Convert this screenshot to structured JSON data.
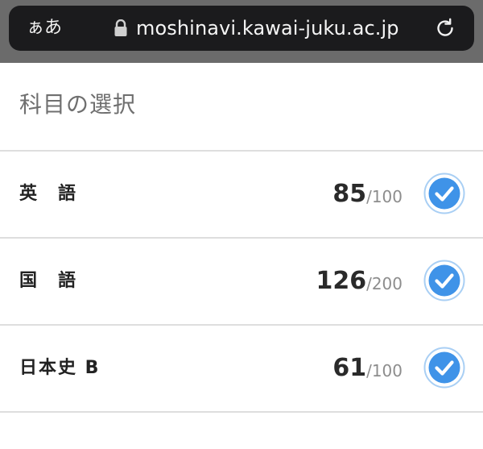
{
  "browser": {
    "text_size_label": "ぁあ",
    "url": "moshinavi.kawai-juku.ac.jp"
  },
  "page": {
    "title": "科目の選択"
  },
  "subjects": [
    {
      "name": "英　語",
      "score": "85",
      "max": "/100",
      "selected": true
    },
    {
      "name": "国　語",
      "score": "126",
      "max": "/200",
      "selected": true
    },
    {
      "name": "日本史 B",
      "score": "61",
      "max": "/100",
      "selected": true
    }
  ],
  "colors": {
    "check_fill": "#3f93e8",
    "check_ring": "#a9cff4"
  }
}
